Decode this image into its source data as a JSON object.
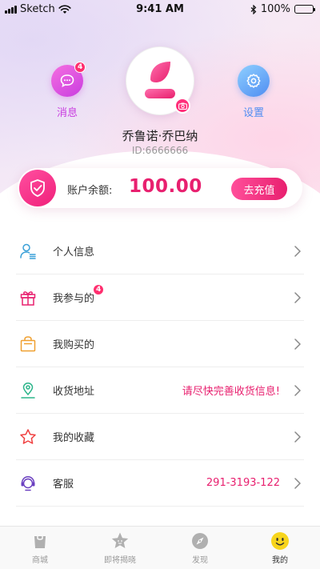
{
  "status_bar": {
    "carrier": "Sketch",
    "time": "9:41 AM",
    "battery": "100%"
  },
  "profile": {
    "messages_label": "消息",
    "messages_badge": "4",
    "settings_label": "设置",
    "name": "乔鲁诺·乔巴纳",
    "id": "ID:6666666"
  },
  "balance": {
    "label": "账户余额:",
    "value": "100.00",
    "recharge_label": "去充值"
  },
  "menu": [
    {
      "label": "个人信息",
      "icon": "user-list-icon",
      "color": "#3aa0d8"
    },
    {
      "label": "我参与的",
      "icon": "gift-icon",
      "color": "#e8206f",
      "badge": "4"
    },
    {
      "label": "我购买的",
      "icon": "shopping-bag-icon",
      "color": "#f0a030"
    },
    {
      "label": "收货地址",
      "icon": "location-pin-icon",
      "color": "#2cb58a",
      "extra": "请尽快完善收货信息!"
    },
    {
      "label": "我的收藏",
      "icon": "star-outline-icon",
      "color": "#f04040"
    },
    {
      "label": "客服",
      "icon": "customer-service-icon",
      "color": "#6a3fc0",
      "extra": "291-3193-122"
    }
  ],
  "tabs": [
    {
      "label": "商城",
      "icon": "shop-bag-icon"
    },
    {
      "label": "即将揭晓",
      "icon": "star-face-icon"
    },
    {
      "label": "发现",
      "icon": "compass-icon"
    },
    {
      "label": "我的",
      "icon": "smiley-icon",
      "active": true
    }
  ],
  "colors": {
    "accent": "#e8206f",
    "active_tab": "#f7d51d"
  }
}
